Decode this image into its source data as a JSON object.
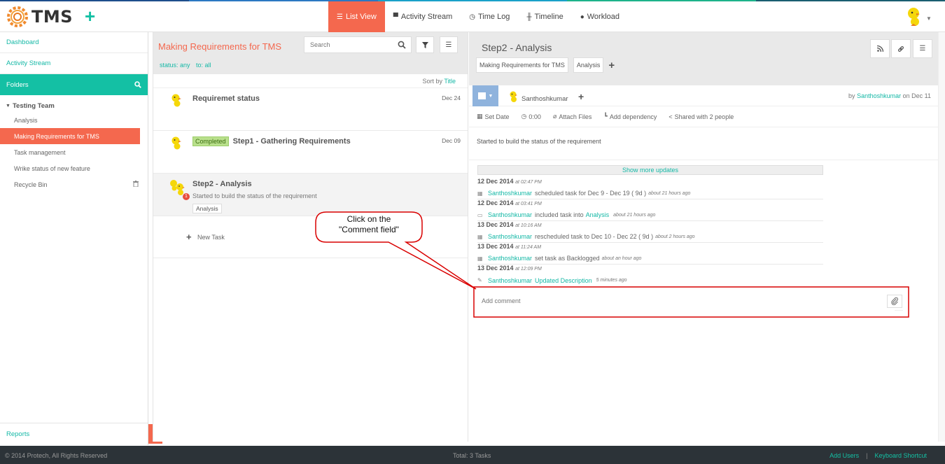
{
  "app": {
    "name": "TMS",
    "accent": "#f4684e",
    "teal": "#14c0a4"
  },
  "nav": {
    "tabs": [
      {
        "label": "List View",
        "icon": "list-icon",
        "active": true
      },
      {
        "label": "Activity Stream",
        "icon": "chat-icon"
      },
      {
        "label": "Time Log",
        "icon": "clock-icon"
      },
      {
        "label": "Timeline",
        "icon": "timeline-icon"
      },
      {
        "label": "Workload",
        "icon": "user-icon"
      }
    ]
  },
  "sidebar": {
    "dashboard": "Dashboard",
    "activity_stream": "Activity Stream",
    "folders": "Folders",
    "team": "Testing Team",
    "items": [
      "Analysis",
      "Making Requirements for TMS",
      "Task management",
      "Wrike status of new feature",
      "Recycle Bin"
    ],
    "reports": "Reports"
  },
  "list": {
    "title": "Making Requirements for TMS",
    "search_placeholder": "Search",
    "filter_status": "status: any",
    "filter_to": "to: all",
    "sort_label": "Sort by",
    "sort_value": "Title",
    "tasks": [
      {
        "title": "Requiremet status",
        "date": "Dec 24"
      },
      {
        "badge": "Completed",
        "title": "Step1 - Gathering Requirements",
        "date": "Dec 09"
      },
      {
        "title": "Step2 - Analysis",
        "desc": "Started to build the status of the requirement",
        "tag": "Analysis",
        "count": "1"
      }
    ],
    "new_task": "New Task"
  },
  "detail": {
    "title": "Step2 - Analysis",
    "tags": [
      "Making Requirements for TMS",
      "Analysis"
    ],
    "assignee": "Santhoshkumar",
    "by_prefix": "by",
    "by_user": "Santhoshkumar",
    "by_date": "on Dec 11",
    "actions": {
      "set_date": "Set Date",
      "time": "0:00",
      "attach": "Attach Files",
      "dependency": "Add dependency",
      "shared": "Shared with 2 people"
    },
    "description": "Started to build the status of the requirement",
    "show_more": "Show more updates",
    "updates": [
      {
        "date": "12 Dec 2014",
        "time": "at 02:47 PM",
        "icon": "calendar-icon",
        "user": "Santhoshkumar",
        "text": "scheduled task for Dec 9 - Dec 19 ( 9d )",
        "link": "",
        "ago": "about 21 hours ago"
      },
      {
        "date": "12 Dec 2014",
        "time": "at 03:41 PM",
        "icon": "folder-icon",
        "user": "Santhoshkumar",
        "text": "included task into",
        "link": "Analysis",
        "ago": "about 21 hours ago"
      },
      {
        "date": "13 Dec 2014",
        "time": "at 10:16 AM",
        "icon": "calendar-icon",
        "user": "Santhoshkumar",
        "text": "rescheduled task to Dec 10 - Dec 22 ( 9d )",
        "link": "",
        "ago": "about 2 hours ago"
      },
      {
        "date": "13 Dec 2014",
        "time": "at 11:24 AM",
        "icon": "calendar-icon",
        "user": "Santhoshkumar",
        "text": "set task as Backlogged",
        "link": "",
        "ago": "about an hour ago"
      },
      {
        "date": "13 Dec 2014",
        "time": "at 12:09 PM",
        "icon": "pencil-icon",
        "user": "Santhoshkumar",
        "text": "",
        "link": "Updated Description",
        "ago": "5 minutes ago"
      }
    ],
    "comment_placeholder": "Add comment"
  },
  "footer": {
    "copyright": "© 2014 Protech, All Rights Reserved",
    "total": "Total: 3 Tasks",
    "add_users": "Add Users",
    "separator": "|",
    "keyboard": "Keyboard Shortcut"
  },
  "callout": {
    "line1": "Click on the",
    "line2": "\"Comment field\""
  }
}
